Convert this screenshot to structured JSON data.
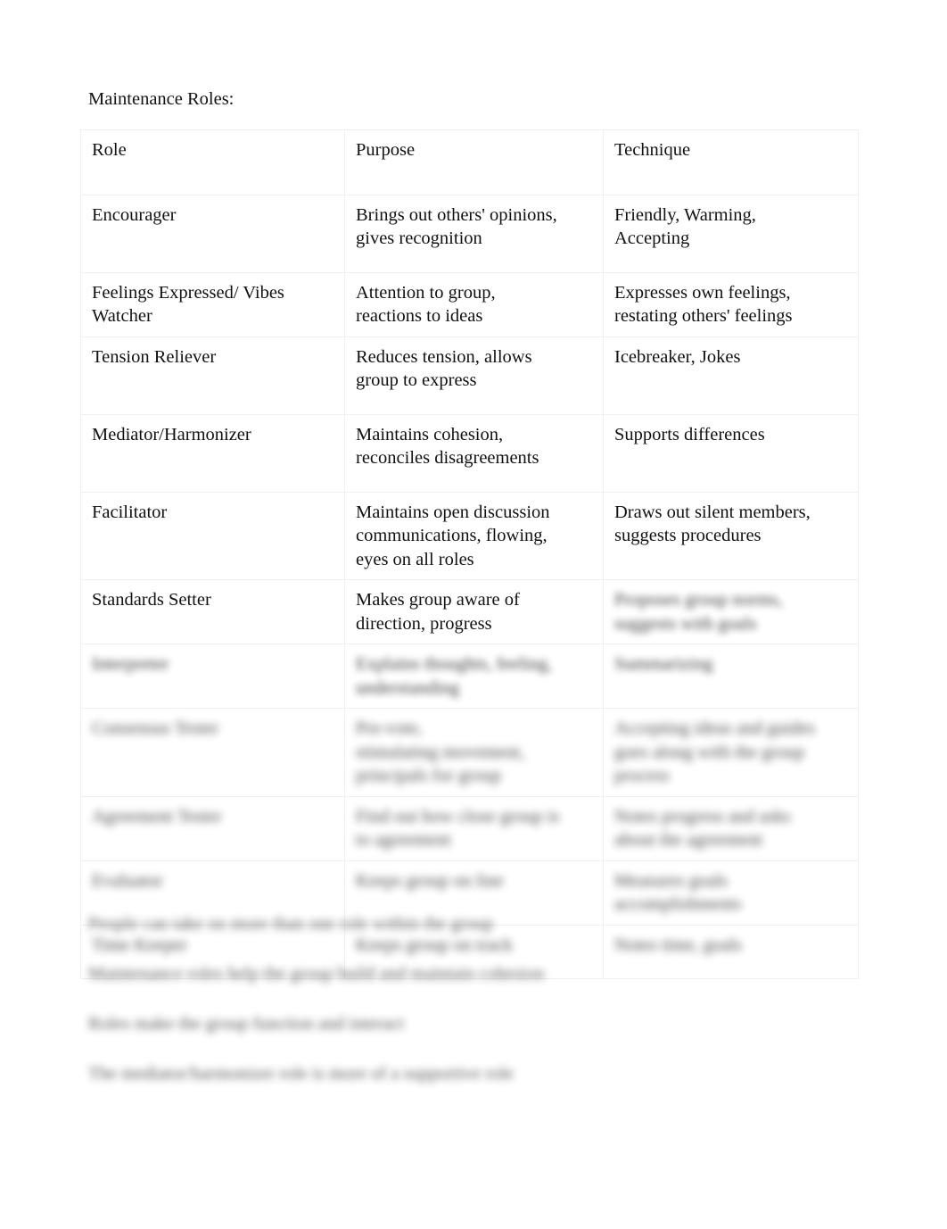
{
  "document": {
    "title": "Maintenance Roles:"
  },
  "table": {
    "headers": {
      "role": "Role",
      "purpose": "Purpose",
      "technique": "Technique"
    },
    "rows": [
      {
        "role": "Encourager",
        "purpose_lines": [
          "Brings out others' opinions,",
          "gives recognition"
        ],
        "technique_lines": [
          "Friendly, Warming,",
          "Accepting"
        ],
        "legible": true
      },
      {
        "role_lines": [
          "Feelings Expressed/ Vibes",
          "Watcher"
        ],
        "purpose_lines": [
          "Attention to group,",
          "reactions to ideas"
        ],
        "technique_lines": [
          "Expresses own feelings,",
          "restating others' feelings"
        ],
        "legible": true
      },
      {
        "role": "Tension Reliever",
        "purpose_lines": [
          "Reduces tension, allows",
          "group to express"
        ],
        "technique_lines": [
          "Icebreaker, Jokes"
        ],
        "legible": true
      },
      {
        "role": "Mediator/Harmonizer",
        "purpose_lines": [
          "Maintains cohesion,",
          "reconciles disagreements"
        ],
        "technique_lines": [
          "Supports differences"
        ],
        "legible": true
      },
      {
        "role": "Facilitator",
        "purpose_lines": [
          "Maintains open discussion",
          "communications, flowing,",
          "eyes on all roles"
        ],
        "technique_lines": [
          "Draws out silent members,",
          "suggests procedures"
        ],
        "legible": true
      },
      {
        "role": "Standards Setter",
        "purpose_lines": [
          "Makes group aware of",
          "direction, progress"
        ],
        "technique_lines": [
          "Proposes group norms,",
          "suggests with goals"
        ],
        "legible": "partial",
        "note": "role and purpose legible; technique column blurred/illegible"
      },
      {
        "role": "Interpreter",
        "purpose_lines": [
          "Explains thoughts, feeling,",
          "understanding"
        ],
        "technique_lines": [
          "Summarizing"
        ],
        "legible": false
      },
      {
        "role": "Consensus Tester",
        "purpose_lines": [
          "Pre-vote,",
          "stimulating movement,",
          "principals for group"
        ],
        "technique_lines": [
          "Accepting ideas and guides",
          "goes along with the group",
          "process"
        ],
        "legible": false
      },
      {
        "role": "Agreement Tester",
        "purpose_lines": [
          "Find out how close group is",
          "to agreement"
        ],
        "technique_lines": [
          "Notes progress and asks",
          "about the agreement"
        ],
        "legible": false
      },
      {
        "role": "Evaluator",
        "purpose_lines": [
          "Keeps group on line"
        ],
        "technique_lines": [
          "Measures goals",
          "accomplishments"
        ],
        "legible": false
      },
      {
        "role": "Time Keeper",
        "purpose_lines": [
          "Keeps group on track"
        ],
        "technique_lines": [
          "Notes time, goals"
        ],
        "legible": false
      }
    ]
  },
  "notes": [
    "People can take on more than one role within the group",
    "Maintenance roles help the group build and maintain cohesion",
    "Roles make the group function and interact",
    "The mediator/harmonizer role is more of a supportive role"
  ]
}
